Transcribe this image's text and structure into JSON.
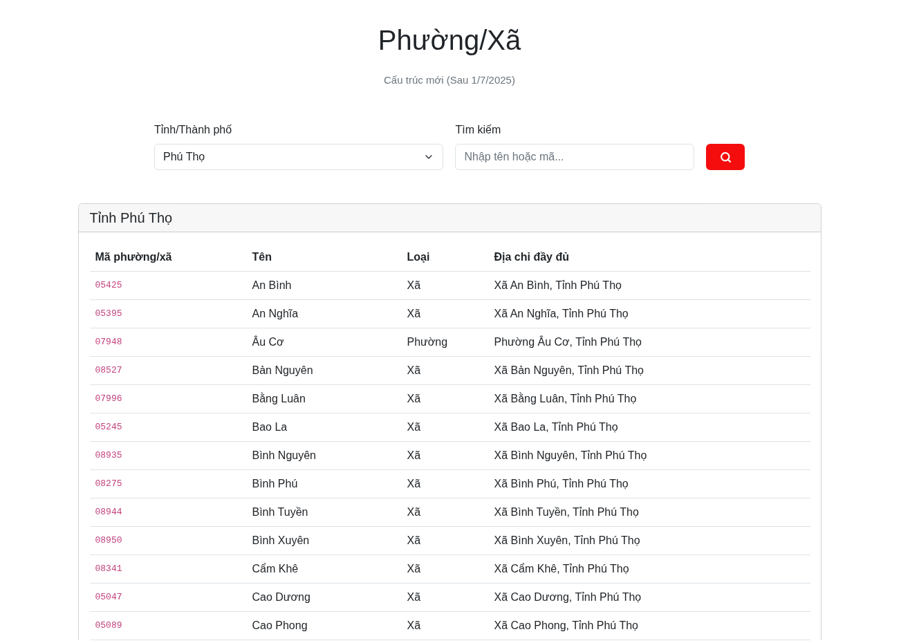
{
  "page": {
    "title": "Phường/Xã",
    "subtitle": "Cấu trúc mới (Sau 1/7/2025)"
  },
  "filters": {
    "province": {
      "label": "Tỉnh/Thành phố",
      "value": "Phú Thọ"
    },
    "search": {
      "label": "Tìm kiếm",
      "placeholder": "Nhập tên hoặc mã..."
    }
  },
  "card": {
    "title": "Tỉnh Phú Thọ",
    "table": {
      "columns": [
        "Mã phường/xã",
        "Tên",
        "Loại",
        "Địa chỉ đầy đủ"
      ],
      "rows": [
        {
          "code": "05425",
          "name": "An Bình",
          "type": "Xã",
          "address": "Xã An Bình, Tỉnh Phú Thọ"
        },
        {
          "code": "05395",
          "name": "An Nghĩa",
          "type": "Xã",
          "address": "Xã An Nghĩa, Tỉnh Phú Thọ"
        },
        {
          "code": "07948",
          "name": "Âu Cơ",
          "type": "Phường",
          "address": "Phường Âu Cơ, Tỉnh Phú Thọ"
        },
        {
          "code": "08527",
          "name": "Bản Nguyên",
          "type": "Xã",
          "address": "Xã Bản Nguyên, Tỉnh Phú Thọ"
        },
        {
          "code": "07996",
          "name": "Bằng Luân",
          "type": "Xã",
          "address": "Xã Bằng Luân, Tỉnh Phú Thọ"
        },
        {
          "code": "05245",
          "name": "Bao La",
          "type": "Xã",
          "address": "Xã Bao La, Tỉnh Phú Thọ"
        },
        {
          "code": "08935",
          "name": "Bình Nguyên",
          "type": "Xã",
          "address": "Xã Bình Nguyên, Tỉnh Phú Thọ"
        },
        {
          "code": "08275",
          "name": "Bình Phú",
          "type": "Xã",
          "address": "Xã Bình Phú, Tỉnh Phú Thọ"
        },
        {
          "code": "08944",
          "name": "Bình Tuyền",
          "type": "Xã",
          "address": "Xã Bình Tuyền, Tỉnh Phú Thọ"
        },
        {
          "code": "08950",
          "name": "Bình Xuyên",
          "type": "Xã",
          "address": "Xã Bình Xuyên, Tỉnh Phú Thọ"
        },
        {
          "code": "08341",
          "name": "Cẩm Khê",
          "type": "Xã",
          "address": "Xã Cẩm Khê, Tỉnh Phú Thọ"
        },
        {
          "code": "05047",
          "name": "Cao Dương",
          "type": "Xã",
          "address": "Xã Cao Dương, Tỉnh Phú Thọ"
        },
        {
          "code": "05089",
          "name": "Cao Phong",
          "type": "Xã",
          "address": "Xã Cao Phong, Tỉnh Phú Thọ"
        }
      ]
    }
  }
}
